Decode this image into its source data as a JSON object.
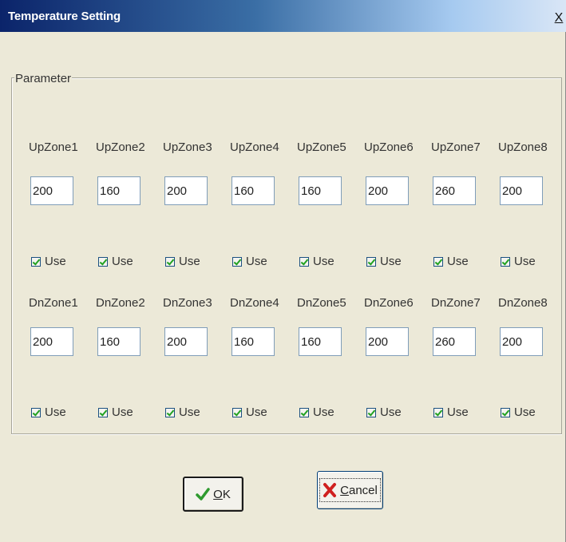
{
  "window": {
    "title": "Temperature Setting",
    "close_label": "X"
  },
  "parameter_group": {
    "legend": "Parameter"
  },
  "up_zones": [
    {
      "label": "UpZone1",
      "value": "200",
      "use_label": "Use",
      "use_checked": true
    },
    {
      "label": "UpZone2",
      "value": "160",
      "use_label": "Use",
      "use_checked": true
    },
    {
      "label": "UpZone3",
      "value": "200",
      "use_label": "Use",
      "use_checked": true
    },
    {
      "label": "UpZone4",
      "value": "160",
      "use_label": "Use",
      "use_checked": true
    },
    {
      "label": "UpZone5",
      "value": "160",
      "use_label": "Use",
      "use_checked": true
    },
    {
      "label": "UpZone6",
      "value": "200",
      "use_label": "Use",
      "use_checked": true
    },
    {
      "label": "UpZone7",
      "value": "260",
      "use_label": "Use",
      "use_checked": true
    },
    {
      "label": "UpZone8",
      "value": "200",
      "use_label": "Use",
      "use_checked": true
    }
  ],
  "dn_zones": [
    {
      "label": "DnZone1",
      "value": "200",
      "use_label": "Use",
      "use_checked": true
    },
    {
      "label": "DnZone2",
      "value": "160",
      "use_label": "Use",
      "use_checked": true
    },
    {
      "label": "DnZone3",
      "value": "200",
      "use_label": "Use",
      "use_checked": true
    },
    {
      "label": "DnZone4",
      "value": "160",
      "use_label": "Use",
      "use_checked": true
    },
    {
      "label": "DnZone5",
      "value": "160",
      "use_label": "Use",
      "use_checked": true
    },
    {
      "label": "DnZone6",
      "value": "200",
      "use_label": "Use",
      "use_checked": true
    },
    {
      "label": "DnZone7",
      "value": "260",
      "use_label": "Use",
      "use_checked": true
    },
    {
      "label": "DnZone8",
      "value": "200",
      "use_label": "Use",
      "use_checked": true
    }
  ],
  "buttons": {
    "ok_label": "OK",
    "ok_icon": "checkmark-icon",
    "cancel_label": "Cancel",
    "cancel_icon": "red-x-icon"
  },
  "colors": {
    "title_bar_start": "#0b246a",
    "window_bg": "#ece9d8",
    "ok_check": "#2e9a2e",
    "cancel_x": "#d02020"
  }
}
